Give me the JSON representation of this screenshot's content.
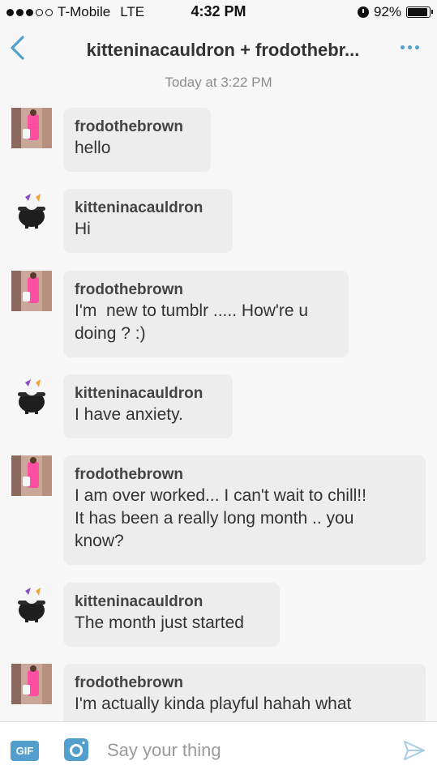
{
  "status_bar": {
    "carrier": "T-Mobile",
    "network": "LTE",
    "time": "4:32 PM",
    "battery": "92%",
    "battery_level": 0.92,
    "signal_bars": 3,
    "signal_total": 5
  },
  "header": {
    "title": "kitteninacauldron + frodothebr..."
  },
  "timestamp": "Today at 3:22 PM",
  "messages": [
    {
      "sender": "frodothebrown",
      "text": "hello"
    },
    {
      "sender": "kitteninacauldron",
      "text": "Hi"
    },
    {
      "sender": "frodothebrown",
      "text": "I'm  new to tumblr ..... How're u\ndoing ? :)"
    },
    {
      "sender": "kitteninacauldron",
      "text": "I have anxiety."
    },
    {
      "sender": "frodothebrown",
      "text": "I am over worked... I can't wait to chill!!\nIt has been a really long month .. you\nknow?"
    },
    {
      "sender": "kitteninacauldron",
      "text": "The month just started"
    },
    {
      "sender": "frodothebrown",
      "text": "I'm actually kinda playful hahah what"
    }
  ],
  "composer": {
    "gif_label": "GIF",
    "placeholder": "Say your thing"
  },
  "colors": {
    "accent": "#529ecc",
    "bubble": "#ededed",
    "background": "#f7f7f7"
  }
}
